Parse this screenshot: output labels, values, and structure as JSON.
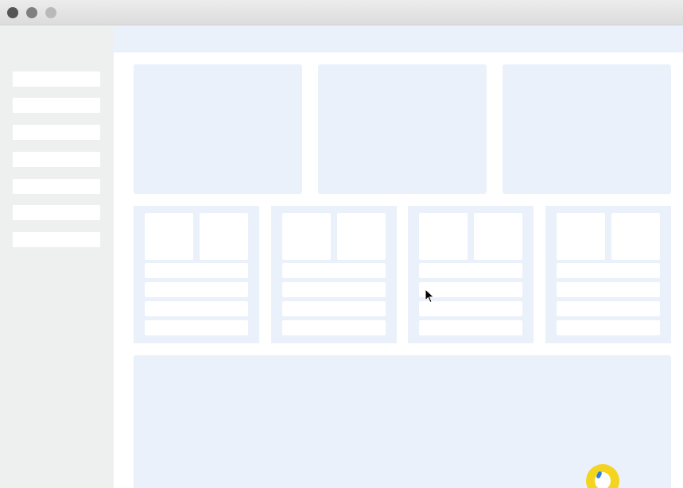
{
  "window": {
    "controls": [
      "close-dot",
      "minimize-dot",
      "maximize-dot"
    ]
  },
  "sidebar": {
    "item_count": 7
  },
  "cards": {
    "large_count": 3,
    "panel_count": 4,
    "panel_rows": 4
  },
  "colors": {
    "placeholder_blue": "#eaf1fa",
    "sidebar_grey": "#eef0ef",
    "badge_yellow": "#f3d41f",
    "badge_blue": "#2f7fd6"
  },
  "icons": {
    "cursor": "mouse-pointer-icon",
    "badge": "yellow-badge-icon"
  }
}
